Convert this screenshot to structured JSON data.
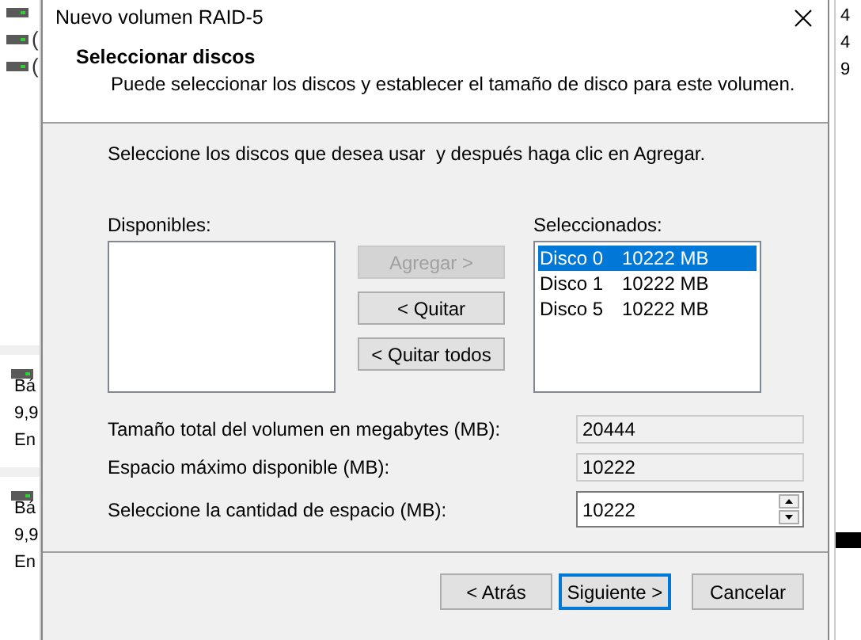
{
  "window": {
    "title": "Nuevo volumen RAID-5"
  },
  "header": {
    "title": "Seleccionar discos",
    "subtitle": "Puede seleccionar los discos y establecer el tamaño de disco para este volumen."
  },
  "instructions": "Seleccione los discos que desea usar  y después haga clic en Agregar.",
  "available": {
    "label": "Disponibles:"
  },
  "move_buttons": [
    {
      "label": "Agregar >",
      "disabled": true
    },
    {
      "label": "< Quitar",
      "disabled": false
    },
    {
      "label": "< Quitar todos",
      "disabled": false
    }
  ],
  "selected_list": {
    "label": "Seleccionados:",
    "items": [
      {
        "name": "Disco 0",
        "size": "10222 MB",
        "selected": true
      },
      {
        "name": "Disco 1",
        "size": "10222 MB",
        "selected": false
      },
      {
        "name": "Disco 5",
        "size": "10222 MB",
        "selected": false
      }
    ]
  },
  "fields": [
    {
      "label": "Tamaño total del volumen en megabytes (MB):",
      "value": "20444",
      "kind": "readonly"
    },
    {
      "label": "Espacio máximo disponible (MB):",
      "value": "10222",
      "kind": "readonly"
    },
    {
      "label": "Seleccione la cantidad de espacio (MB):",
      "value": "10222",
      "kind": "spinner"
    }
  ],
  "buttons": [
    {
      "label": "< Atrás",
      "focused": false
    },
    {
      "label": "Siguiente >",
      "focused": true
    },
    {
      "label": "Cancelar",
      "focused": false
    }
  ],
  "background": {
    "top_marks": [
      "(",
      "("
    ],
    "left_disks": [
      {
        "texts": [
          "Bá",
          "9,9",
          "En"
        ]
      },
      {
        "texts": [
          "Bá",
          "9,9",
          "En"
        ]
      }
    ],
    "right_texts": [
      "4",
      "4",
      "9"
    ]
  }
}
